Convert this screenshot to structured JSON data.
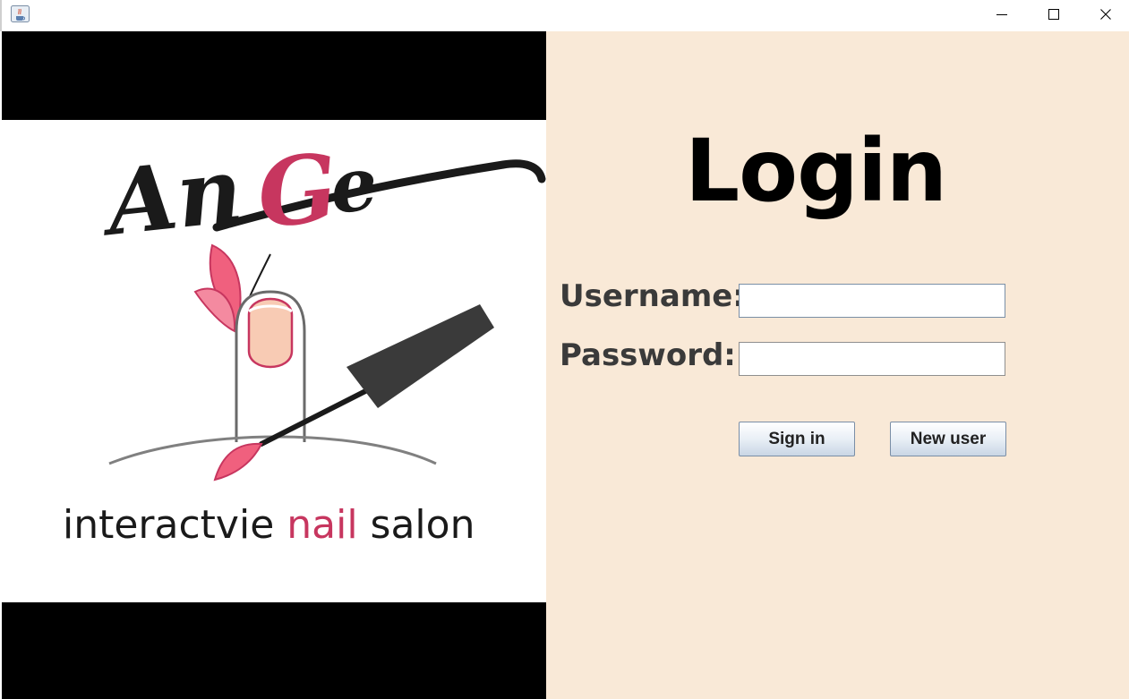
{
  "window": {
    "icon": "java-coffee-icon",
    "controls": {
      "minimize": "minimize-icon",
      "maximize": "maximize-icon",
      "close": "close-icon"
    }
  },
  "logo": {
    "brand": "AnGe",
    "tagline_parts": [
      "interactvie ",
      "nail",
      " salon"
    ],
    "brand_color": "#c7365f",
    "accent_pink": "#f0607e",
    "nail_color": "#f8cbb4"
  },
  "login": {
    "title": "Login",
    "username_label": "Username:",
    "password_label": "Password:",
    "username_value": "",
    "password_value": "",
    "sign_in_label": "Sign in",
    "new_user_label": "New user"
  },
  "colors": {
    "panel_background": "#f9e9d7",
    "label_color": "#3a3a3a",
    "letterbox": "#000000"
  }
}
